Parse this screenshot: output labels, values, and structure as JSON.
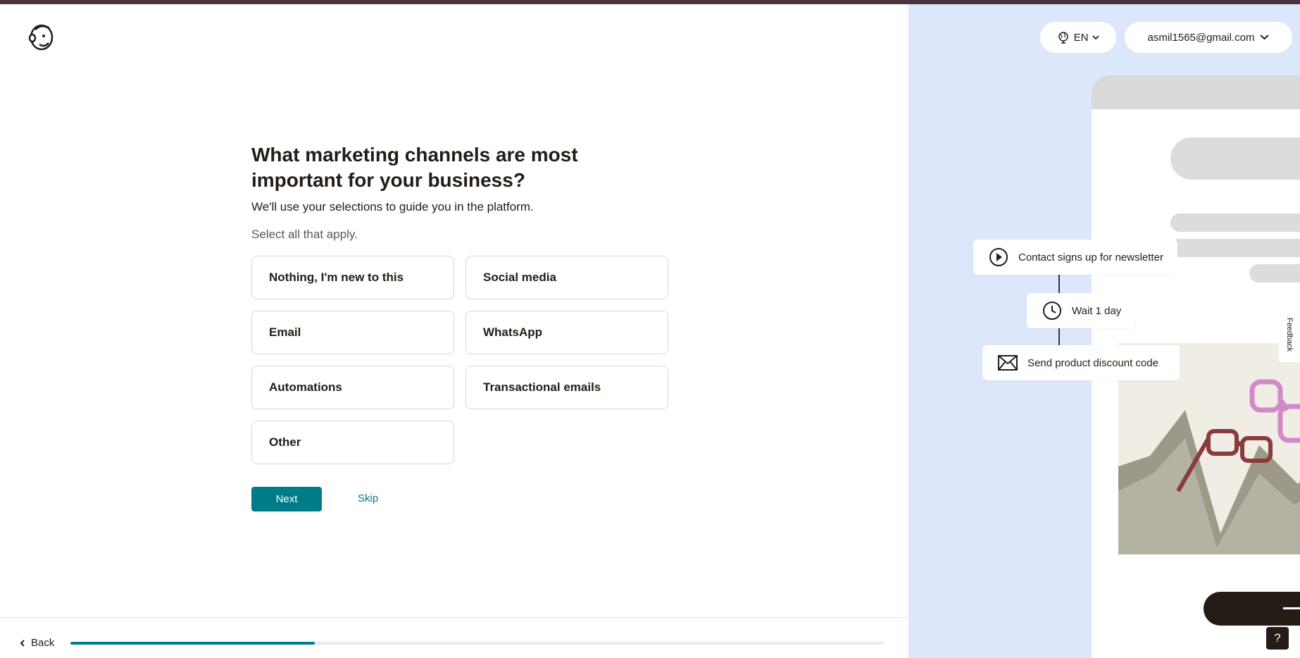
{
  "onboarding": {
    "title": "What marketing channels are most important for your business?",
    "subtitle": "We'll use your selections to guide you in the platform.",
    "hint": "Select all that apply.",
    "options": [
      {
        "label": "Nothing, I'm new to this"
      },
      {
        "label": "Social media"
      },
      {
        "label": "Email"
      },
      {
        "label": "WhatsApp"
      },
      {
        "label": "Automations"
      },
      {
        "label": "Transactional emails"
      },
      {
        "label": "Other"
      }
    ],
    "next_label": "Next",
    "skip_label": "Skip"
  },
  "footer": {
    "back_label": "Back",
    "progress_fraction": 0.3
  },
  "header": {
    "language": "EN",
    "account_email": "asmil1565@gmail.com"
  },
  "preview": {
    "flow_steps": [
      {
        "label": "Contact signs up for newsletter",
        "icon": "play-circle-icon"
      },
      {
        "label": "Wait 1 day",
        "icon": "clock-icon"
      },
      {
        "label": "Send product discount code",
        "icon": "envelope-icon"
      }
    ],
    "feedback_label": "Feedback",
    "help_label": "?"
  },
  "colors": {
    "accent": "#007c89",
    "top_bar": "#4a3240",
    "preview_bg": "#dde7fb",
    "text": "#241c15"
  }
}
